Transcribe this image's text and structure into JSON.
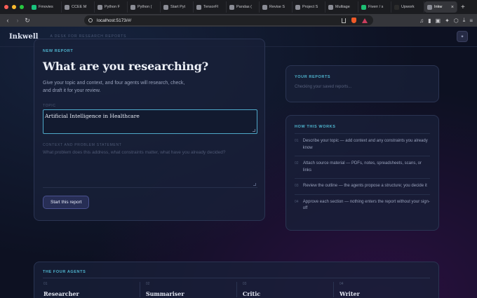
{
  "browser": {
    "traffic_colors": [
      "#ff5f57",
      "#febc2e",
      "#28c840"
    ],
    "tabs": [
      {
        "label": "Fmovies",
        "icon": "play-icon",
        "color": "#19c37d"
      },
      {
        "label": "CCEE M",
        "icon": "page-icon",
        "color": "#8b8d96"
      },
      {
        "label": "Python F",
        "icon": "page-icon",
        "color": "#8b8d96"
      },
      {
        "label": "Python (",
        "icon": "page-icon",
        "color": "#8b8d96"
      },
      {
        "label": "Start Pyt",
        "icon": "page-icon",
        "color": "#8b8d96"
      },
      {
        "label": "TensorFl",
        "icon": "page-icon",
        "color": "#8b8d96"
      },
      {
        "label": "Pandas (",
        "icon": "page-icon",
        "color": "#8b8d96"
      },
      {
        "label": "Revise S",
        "icon": "page-icon",
        "color": "#8b8d96"
      },
      {
        "label": "Project S",
        "icon": "page-icon",
        "color": "#8b8d96"
      },
      {
        "label": "Multiage",
        "icon": "page-icon",
        "color": "#8b8d96"
      },
      {
        "label": "Fiverr / s",
        "icon": "fiverr-icon",
        "color": "#1dbf73"
      },
      {
        "label": "Upwork",
        "icon": "upwork-icon",
        "color": "#2b2b2b"
      },
      {
        "label": "Inkw",
        "icon": "globe-icon",
        "color": "#8b8d96",
        "active": true
      }
    ],
    "url": "localhost:5173/#/"
  },
  "app": {
    "logo": "Inkwell",
    "tagline": "A DESK FOR RESEARCH REPORTS",
    "header_button_icon": "sparkle-icon"
  },
  "new_report": {
    "label": "NEW REPORT",
    "title": "What are you researching?",
    "description": "Give your topic and context, and four agents will research, check, and draft it for your review.",
    "topic_label": "TOPIC",
    "topic_value": "Artificial Intelligence in Healthcare",
    "context_label": "CONTEXT AND PROBLEM STATEMENT",
    "context_placeholder": "What problem does this address, what constraints matter, what have you already decided?",
    "start_button": "Start this report"
  },
  "your_reports": {
    "label": "YOUR REPORTS",
    "status": "Checking your saved reports..."
  },
  "how_it_works": {
    "label": "HOW THIS WORKS",
    "steps": [
      {
        "num": "01",
        "text": "Describe your topic — add context and any constraints you already know"
      },
      {
        "num": "02",
        "text": "Attach source material — PDFs, notes, spreadsheets, scans, or links"
      },
      {
        "num": "03",
        "text": "Review the outline — the agents propose a structure; you decide it"
      },
      {
        "num": "04",
        "text": "Approve each section — nothing enters the report without your sign-off"
      }
    ]
  },
  "four_agents": {
    "label": "THE FOUR AGENTS",
    "agents": [
      {
        "num": "01",
        "name": "Researcher"
      },
      {
        "num": "02",
        "name": "Summariser"
      },
      {
        "num": "03",
        "name": "Critic"
      },
      {
        "num": "04",
        "name": "Writer"
      }
    ]
  }
}
